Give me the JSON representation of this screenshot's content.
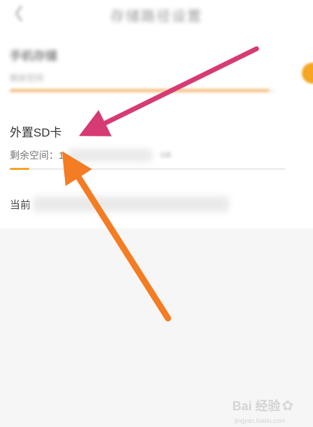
{
  "header": {
    "back_icon": "back-chevron-icon",
    "title": "存储路径设置"
  },
  "internal_storage": {
    "title": "手机存储",
    "subtitle": "剩余空间",
    "usage_fraction": 0.98
  },
  "external_sd": {
    "title": "外置SD卡",
    "remaining_label": "剩余空间：1",
    "remaining_tail": "GB",
    "usage_fraction": 0.07
  },
  "current_path": {
    "label": "当前"
  },
  "watermark": {
    "text": "Bai 经验",
    "url": "jingyan.baidu.com"
  },
  "colors": {
    "accent_orange": "#f5a623",
    "arrow_pink": "#d63b74",
    "arrow_orange": "#f47c22"
  }
}
